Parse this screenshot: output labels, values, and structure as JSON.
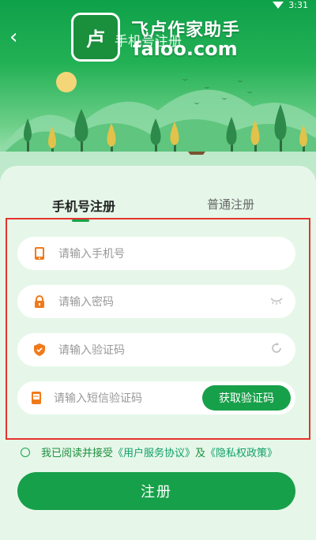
{
  "status_bar": {
    "time": "3:31"
  },
  "header": {
    "title": "手机号注册",
    "logo_char": "卢",
    "brand_name": "飞卢作家助手",
    "brand_domain": "faloo.com"
  },
  "tabs": [
    {
      "label": "手机号注册",
      "active": true
    },
    {
      "label": "普通注册",
      "active": false
    }
  ],
  "form": {
    "phone_placeholder": "请输入手机号",
    "password_placeholder": "请输入密码",
    "captcha_placeholder": "请输入验证码",
    "sms_placeholder": "请输入短信验证码",
    "send_code_label": "获取验证码"
  },
  "agreement": {
    "prefix": "我已阅读并接受",
    "terms_link": "《用户服务协议》",
    "joiner": "及",
    "privacy_link": "《隐私权政策》"
  },
  "register_button": "注册",
  "colors": {
    "accent": "#17a04a",
    "highlight_box": "#e5322d",
    "background": "#e6f7e9",
    "icon_orange": "#f07a1a"
  }
}
